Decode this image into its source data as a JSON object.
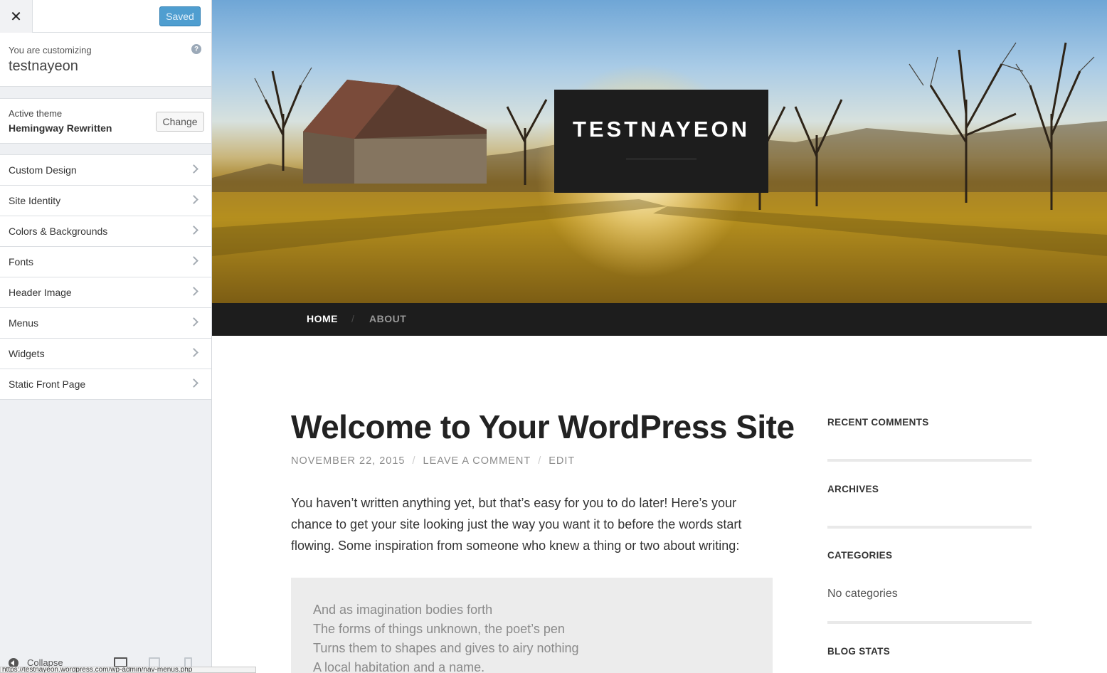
{
  "sidebar": {
    "close_label": "✕",
    "saved_label": "Saved",
    "customizing_label": "You are customizing",
    "site_name": "testnayeon",
    "help_icon": "?",
    "theme_label": "Active theme",
    "theme_name": "Hemingway Rewritten",
    "change_label": "Change",
    "items": [
      {
        "label": "Custom Design"
      },
      {
        "label": "Site Identity"
      },
      {
        "label": "Colors & Backgrounds"
      },
      {
        "label": "Fonts"
      },
      {
        "label": "Header Image"
      },
      {
        "label": "Menus"
      },
      {
        "label": "Widgets"
      },
      {
        "label": "Static Front Page"
      }
    ],
    "collapse_label": "Collapse"
  },
  "status_url": "https://testnayeon.wordpress.com/wp-admin/nav-menus.php",
  "preview": {
    "site_title": "TESTNAYEON",
    "nav": {
      "home": "HOME",
      "separator": "/",
      "about": "ABOUT"
    },
    "post": {
      "title": "Welcome to Your WordPress Site",
      "date": "NOVEMBER 22, 2015",
      "comment": "LEAVE A COMMENT",
      "edit": "EDIT",
      "separator": "/",
      "body": "You haven’t written anything yet, but that’s easy for you to do later! Here’s your chance to get your site looking just the way you want it to before the words start flowing. Some inspiration from someone who knew a thing or two about writing:",
      "quote_lines": [
        "And as imagination bodies forth",
        "The forms of things unknown, the poet’s pen",
        "Turns them to shapes and gives to airy nothing",
        "A local habitation and a name."
      ]
    },
    "widgets": {
      "recent_comments": "RECENT COMMENTS",
      "archives": "ARCHIVES",
      "categories": "CATEGORIES",
      "categories_text": "No categories",
      "blog_stats": "BLOG STATS"
    }
  },
  "colors": {
    "saved_button": "#4f9ed0",
    "header_dark": "#1d1d1d",
    "sidebar_bg": "#eef0f3"
  }
}
